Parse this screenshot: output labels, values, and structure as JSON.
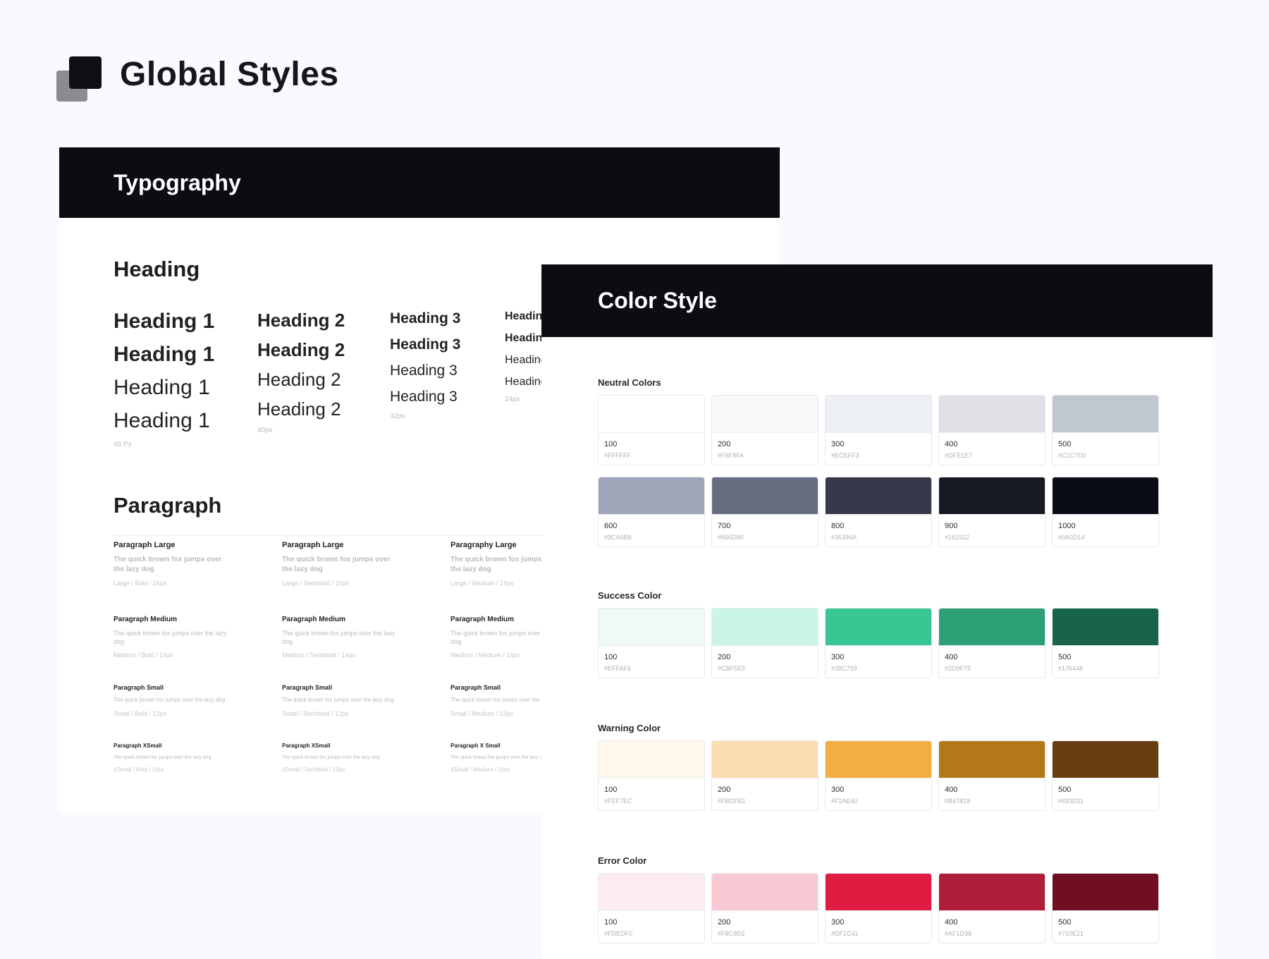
{
  "page": {
    "title": "Global Styles"
  },
  "typography": {
    "title": "Typography",
    "heading_section": "Heading",
    "heading_columns": [
      {
        "label": "Heading 1",
        "size_label": "48 Px",
        "font_size": 30,
        "line_gap": 17
      },
      {
        "label": "Heading 2",
        "size_label": "40px",
        "font_size": 26,
        "line_gap": 16
      },
      {
        "label": "Heading 3",
        "size_label": "32px",
        "font_size": 21,
        "line_gap": 16
      },
      {
        "label": "Heading",
        "size_label": "24px",
        "font_size": 16,
        "line_gap": 15
      }
    ],
    "paragraph_section": "Paragraph",
    "paragraph_rows": [
      {
        "items": [
          {
            "label": "Paragraph Large",
            "text": "The quick brown fox jumps over the lazy dog",
            "meta": "Large / Bold / 16px"
          },
          {
            "label": "Paragraph Large",
            "text": "The quick brown fox jumps over the lazy dog",
            "meta": "Large / Semibold / 16px"
          },
          {
            "label": "Paragraphy Large",
            "text": "The quick brown fox jumps over the lazy dog",
            "meta": "Large / Medium / 16px"
          }
        ]
      },
      {
        "items": [
          {
            "label": "Paragraph Medium",
            "text": "The quick brown fox jumps over the lazy dog",
            "meta": "Medium / Bold / 14px"
          },
          {
            "label": "Paragraph Medium",
            "text": "The quick brown fox jumps over the lazy dog",
            "meta": "Medium / Semibold / 14px"
          },
          {
            "label": "Paragraph Medium",
            "text": "The quick brown fox jumps over the lazy dog",
            "meta": "Medium / Medium / 14px"
          }
        ]
      },
      {
        "items": [
          {
            "label": "Paragraph Small",
            "text": "The quick brown fox jumps over the lazy dog",
            "meta": "Small / Bold / 12px"
          },
          {
            "label": "Paragraph Small",
            "text": "The quick brown fox jumps over the lazy dog",
            "meta": "Small / Semibold / 12px"
          },
          {
            "label": "Paragraph Small",
            "text": "The quick brown fox jumps over the lazy dog",
            "meta": "Small / Medium / 12px"
          }
        ]
      },
      {
        "items": [
          {
            "label": "Paragraph XSmall",
            "text": "The quick brown fox jumps over the lazy dog",
            "meta": "XSmall / Bold / 10px"
          },
          {
            "label": "Paragraph XSmall",
            "text": "The quick brown fox jumps over the lazy dog",
            "meta": "XSmall / Semibold / 10px"
          },
          {
            "label": "Paragraph X Small",
            "text": "The quick brown fox jumps over the lazy dog",
            "meta": "XSmall / Medium / 10px"
          }
        ]
      }
    ]
  },
  "color_style": {
    "title": "Color Style",
    "groups": [
      {
        "name": "Neutral Colors",
        "swatches": [
          {
            "step": "100",
            "hex": "#FFFFFF"
          },
          {
            "step": "200",
            "hex": "#F6F8FA"
          },
          {
            "step": "300",
            "hex": "#ECEFF3"
          },
          {
            "step": "400",
            "hex": "#DFE1E7"
          },
          {
            "step": "500",
            "hex": "#C1C7D0"
          },
          {
            "step": "600",
            "hex": "#9CA6B8"
          },
          {
            "step": "700",
            "hex": "#666D80"
          },
          {
            "step": "800",
            "hex": "#36394A"
          },
          {
            "step": "900",
            "hex": "#161922"
          },
          {
            "step": "1000",
            "hex": "#0A0D14"
          }
        ]
      },
      {
        "name": "Success Color",
        "swatches": [
          {
            "step": "100",
            "hex": "#EFFAF6"
          },
          {
            "step": "200",
            "hex": "#CBF5E5"
          },
          {
            "step": "300",
            "hex": "#38C793"
          },
          {
            "step": "400",
            "hex": "#2D9F75"
          },
          {
            "step": "500",
            "hex": "#176448"
          }
        ]
      },
      {
        "name": "Warning Color",
        "swatches": [
          {
            "step": "100",
            "hex": "#FEF7EC"
          },
          {
            "step": "200",
            "hex": "#FBDFB1"
          },
          {
            "step": "300",
            "hex": "#F2AE40"
          },
          {
            "step": "400",
            "hex": "#B47818"
          },
          {
            "step": "500",
            "hex": "#693D11"
          }
        ]
      },
      {
        "name": "Error Color",
        "swatches": [
          {
            "step": "100",
            "hex": "#FDEDF0"
          },
          {
            "step": "200",
            "hex": "#F8C9D2"
          },
          {
            "step": "300",
            "hex": "#DF1C41"
          },
          {
            "step": "400",
            "hex": "#AF1D38"
          },
          {
            "step": "500",
            "hex": "#710E21"
          }
        ]
      }
    ]
  }
}
